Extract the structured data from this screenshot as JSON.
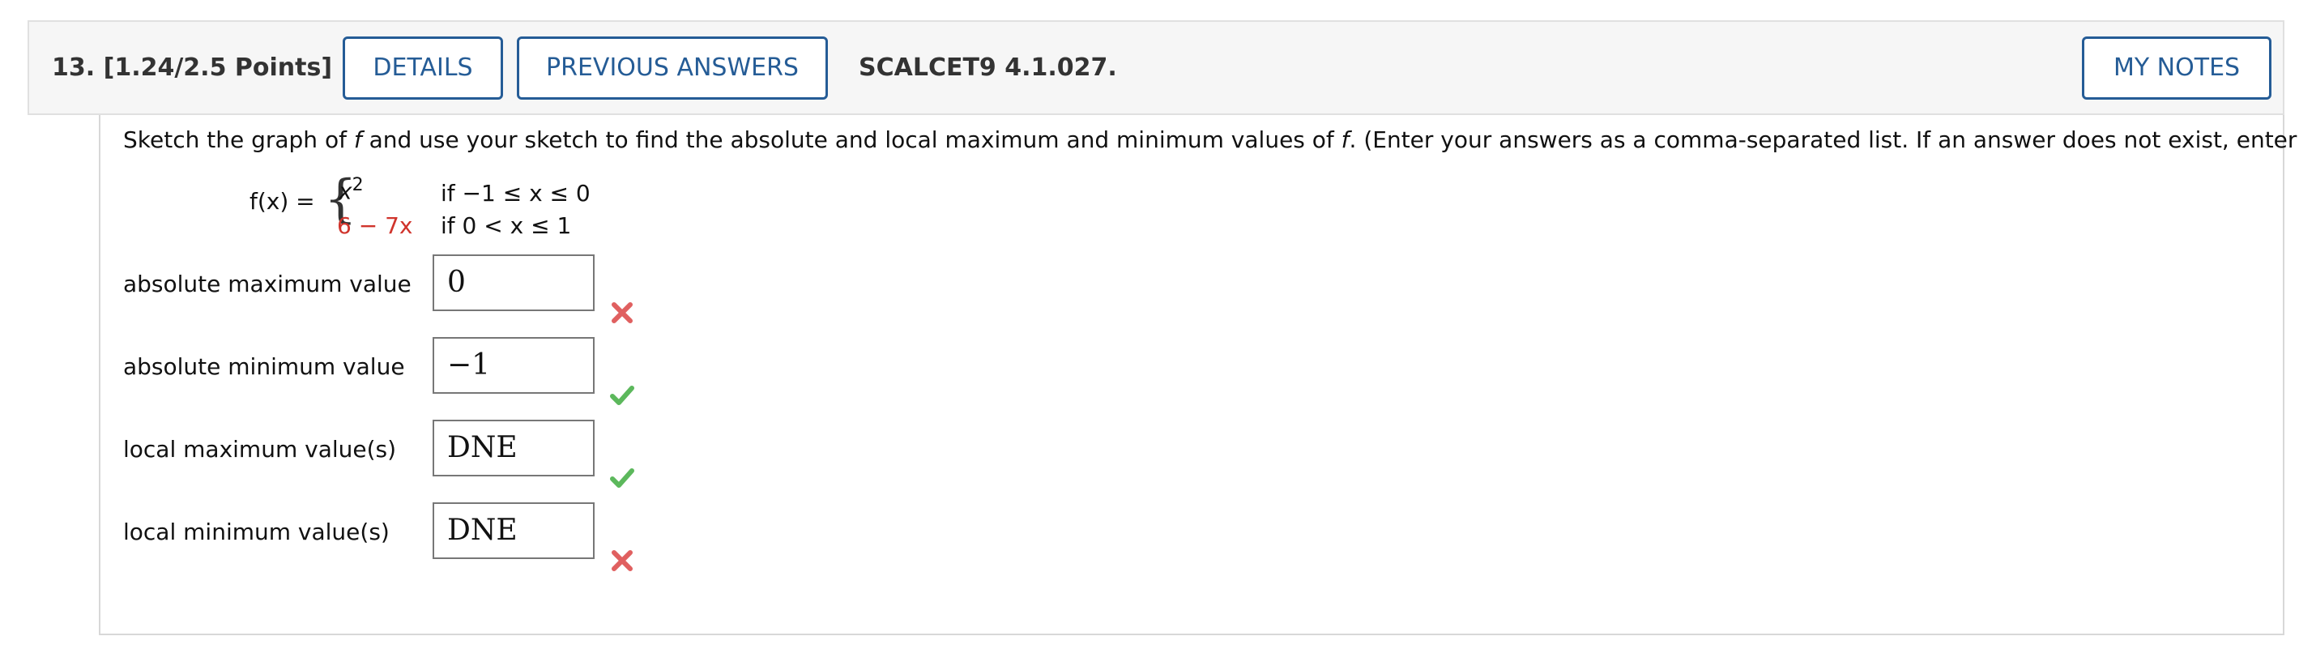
{
  "header": {
    "question_number": "13.",
    "points": "[1.24/2.5 Points]",
    "details_label": "DETAILS",
    "previous_answers_label": "PREVIOUS ANSWERS",
    "problem_code": "SCALCET9 4.1.027.",
    "my_notes_label": "MY NOTES"
  },
  "problem": {
    "instructions_pre": "Sketch the graph of ",
    "f1": "f",
    "instructions_mid": " and use your sketch to find the absolute and local maximum and minimum values of ",
    "f2": "f",
    "instructions_post": ". (Enter your answers as a comma-separated list. If an answer does not exist, enter DNE.)",
    "function_label": "f(x) =",
    "piece1_expr": "x",
    "piece1_exp": "2",
    "piece1_cond": "if −1 ≤ x ≤ 0",
    "piece2_expr": "6 − 7x",
    "piece2_cond": "if 0 < x ≤ 1"
  },
  "answers": [
    {
      "label": "absolute maximum value",
      "value": "0",
      "status": "incorrect"
    },
    {
      "label": "absolute minimum value",
      "value": "−1",
      "status": "correct"
    },
    {
      "label": "local maximum value(s)",
      "value": "DNE",
      "status": "correct"
    },
    {
      "label": "local minimum value(s)",
      "value": "DNE",
      "status": "incorrect"
    }
  ],
  "colors": {
    "accent": "#255c96",
    "correct": "#5cb85c",
    "incorrect": "#e06060",
    "highlight": "#d0342c"
  },
  "icons": {
    "correct": "check-icon",
    "incorrect": "cross-icon"
  }
}
